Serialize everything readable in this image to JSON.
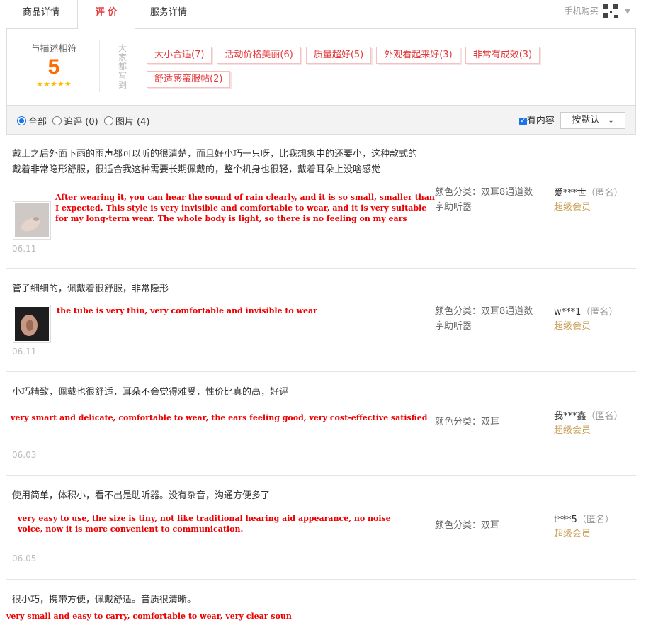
{
  "tabs": {
    "details": "商品详情",
    "reviews": "评 价",
    "service": "服务详情",
    "mobile_buy": "手机购买"
  },
  "summary": {
    "match_label": "与描述相符",
    "score": "5",
    "stars": "★★★★★",
    "vertical_label": "大家都写到",
    "tags": [
      "大小合适(7)",
      "活动价格美丽(6)",
      "质量超好(5)",
      "外观看起来好(3)",
      "非常有成效(3)",
      "舒适感蛮服帖(2)"
    ]
  },
  "filters": {
    "all": "全部",
    "followup": "追评 (0)",
    "pictures": "图片 (4)",
    "has_content": "有内容",
    "sort": "按默认"
  },
  "reviews": [
    {
      "text": "戴上之后外面下雨的雨声都可以听的很清楚，而且好小巧一只呀，比我想象中的还要小，这种款式的戴着非常隐形舒服，很适合我这种需要长期佩戴的，整个机身也很轻，戴着耳朵上没啥感觉",
      "english": "After wearing it, you can hear the sound of rain clearly, and it is so small, smaller than I expected. This style is very invisible and comfortable to wear, and it is very suitable for my long-term wear. The whole body is light, so there is no feeling on my ears",
      "date": "06.11",
      "sku": "颜色分类：双耳8通道数字助听器",
      "user": "爱***世",
      "anon": "（匿名）",
      "vip": "超级会员"
    },
    {
      "text": "管子细细的，佩戴着很舒服，非常隐形",
      "english": "the tube is very thin, very comfortable and invisible to wear",
      "date": "06.11",
      "sku": "颜色分类：双耳8通道数字助听器",
      "user": "w***1",
      "anon": "（匿名）",
      "vip": "超级会员"
    },
    {
      "text": "小巧精致，佩戴也很舒适，耳朵不会觉得难受，性价比真的高，好评",
      "english": "very smart and delicate, comfortable to wear, the ears feeling good, very cost-effective satisfied",
      "date": "06.03",
      "sku": "颜色分类：双耳",
      "user": "我***鑫",
      "anon": "（匿名）",
      "vip": "超级会员"
    },
    {
      "text": "使用简单，体积小，看不出是助听器。没有杂音，沟通方便多了",
      "english": "very easy to use, the size is tiny, not like traditional hearing aid appearance, no noise voice, now it is more convenient to communication.",
      "date": "06.05",
      "sku": "颜色分类：双耳",
      "user": "t***5",
      "anon": "（匿名）",
      "vip": "超级会员"
    },
    {
      "text": "很小巧，携带方便，佩戴舒适。音质很清晰。",
      "english": "very small and easy to carry, comfortable to wear, very clear soun"
    }
  ]
}
